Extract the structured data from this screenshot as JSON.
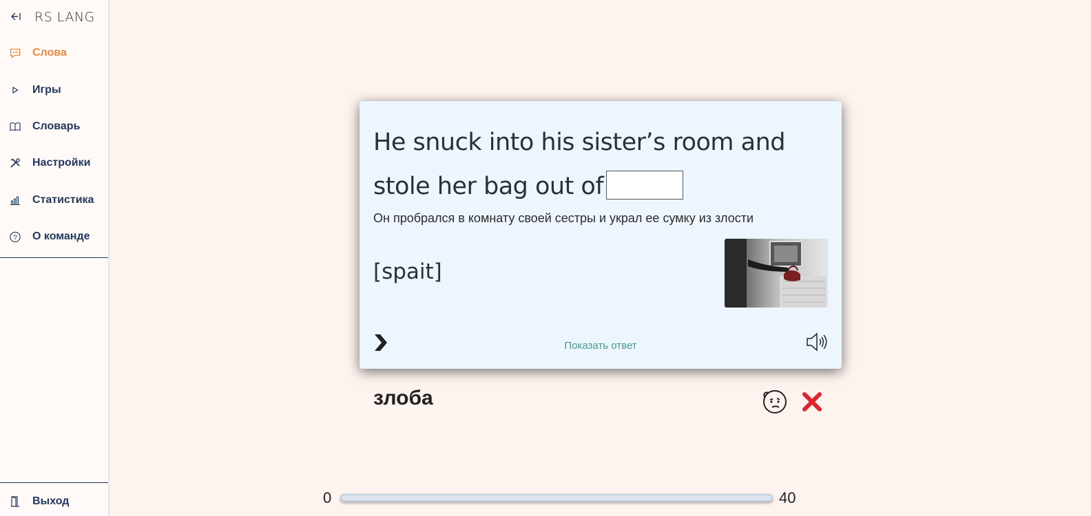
{
  "sidebar": {
    "logo": "RS LANG",
    "items": [
      {
        "label": "Слова",
        "icon": "speech-bubble-icon",
        "active": true
      },
      {
        "label": "Игры",
        "icon": "play-icon"
      },
      {
        "label": "Словарь",
        "icon": "book-icon"
      },
      {
        "label": "Настройки",
        "icon": "tools-icon"
      },
      {
        "label": "Статистика",
        "icon": "bar-chart-icon"
      },
      {
        "label": "О команде",
        "icon": "question-icon"
      }
    ],
    "logout": {
      "label": "Выход",
      "icon": "door-icon"
    }
  },
  "card": {
    "sentence": "He snuck into his sister’s room and stole her bag out of",
    "answer_value": "",
    "translation": "Он пробрался в комнату своей сестры и украл ее сумку из злости",
    "transcription": "[spait]",
    "show_answer": "Показать ответ"
  },
  "word": "злоба",
  "progress": {
    "min": "0",
    "max": "40",
    "value": 0
  },
  "colors": {
    "accent": "#f0873d",
    "nav": "#22375e",
    "background": "#fdf3ef",
    "card": "#edf5fe",
    "link": "#4a9a8e",
    "close": "#e0232e"
  }
}
